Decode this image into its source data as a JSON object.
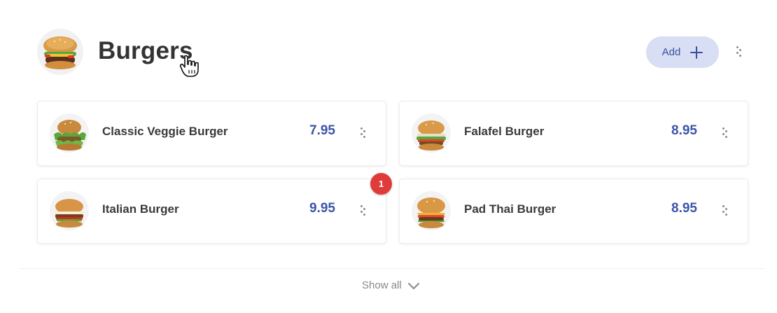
{
  "category": {
    "title": "Burgers",
    "add_label": "Add"
  },
  "items": [
    {
      "name": "Classic Veggie Burger",
      "price": "7.95"
    },
    {
      "name": "Falafel Burger",
      "price": "8.95"
    },
    {
      "name": "Italian Burger",
      "price": "9.95"
    },
    {
      "name": "Pad Thai Burger",
      "price": "8.95"
    }
  ],
  "notification": {
    "count": "1"
  },
  "footer": {
    "show_all_label": "Show all"
  },
  "colors": {
    "accent": "#3c54a8",
    "add_button_bg": "#d8def3",
    "badge": "#e03b3b"
  },
  "icons": [
    "burger-image",
    "plus-icon",
    "kebab-icon",
    "chevron-down-icon",
    "hand-cursor-icon"
  ]
}
